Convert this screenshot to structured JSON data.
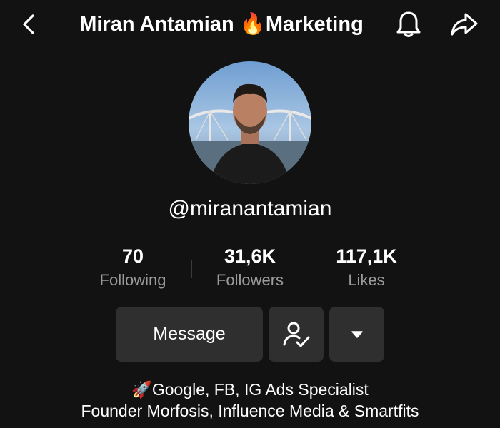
{
  "header": {
    "title": "Miran Antamian 🔥Marketing",
    "back_icon": "chevron-left-icon",
    "bell_icon": "bell-icon",
    "share_icon": "share-arrow-icon"
  },
  "profile": {
    "avatar_alt": "profile-photo",
    "handle": "@miranantamian"
  },
  "stats": [
    {
      "value": "70",
      "label": "Following"
    },
    {
      "value": "31,6K",
      "label": "Followers"
    },
    {
      "value": "117,1K",
      "label": "Likes"
    }
  ],
  "actions": {
    "message_label": "Message",
    "follow_icon": "user-check-icon",
    "more_icon": "caret-down-icon"
  },
  "bio": {
    "line1": "🚀Google, FB, IG Ads Specialist",
    "line2": "Founder Morfosis, Influence Media & Smartfits"
  },
  "colors": {
    "background": "#121212",
    "button_bg": "#2f2f2f",
    "secondary_text": "#9b9b9b"
  }
}
